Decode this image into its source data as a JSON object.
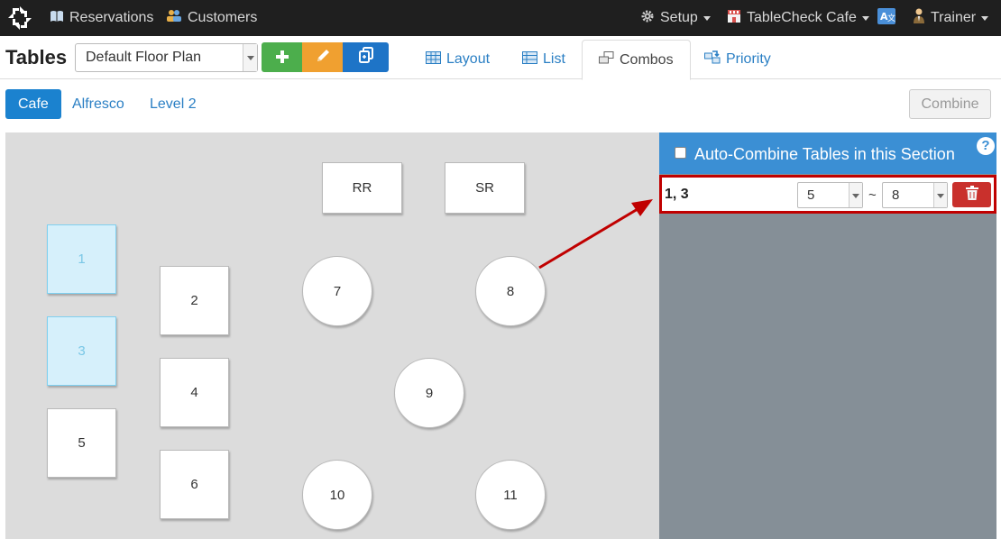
{
  "topnav": {
    "reservations": "Reservations",
    "customers": "Customers",
    "setup": "Setup",
    "venue": "TableCheck Cafe",
    "user": "Trainer"
  },
  "toolbar": {
    "title": "Tables",
    "floor_plan": "Default Floor Plan",
    "add_icon": "plus-icon",
    "edit_icon": "pencil-icon",
    "copy_icon": "copy-icon",
    "tabs": [
      {
        "label": "Layout",
        "icon": "grid-icon",
        "active": false
      },
      {
        "label": "List",
        "icon": "list-icon",
        "active": false
      },
      {
        "label": "Combos",
        "icon": "combo-icon",
        "active": true
      },
      {
        "label": "Priority",
        "icon": "priority-icon",
        "active": false
      }
    ]
  },
  "sections": {
    "items": [
      {
        "label": "Cafe",
        "active": true
      },
      {
        "label": "Alfresco",
        "active": false
      },
      {
        "label": "Level 2",
        "active": false
      }
    ],
    "combine_label": "Combine"
  },
  "floor": {
    "tables": [
      {
        "label": "RR",
        "shape": "rect",
        "selected": false
      },
      {
        "label": "SR",
        "shape": "rect",
        "selected": false
      },
      {
        "label": "1",
        "shape": "rect",
        "selected": true
      },
      {
        "label": "3",
        "shape": "rect",
        "selected": true
      },
      {
        "label": "5",
        "shape": "rect",
        "selected": false
      },
      {
        "label": "2",
        "shape": "rect",
        "selected": false
      },
      {
        "label": "4",
        "shape": "rect",
        "selected": false
      },
      {
        "label": "6",
        "shape": "rect",
        "selected": false
      },
      {
        "label": "7",
        "shape": "round",
        "selected": false
      },
      {
        "label": "8",
        "shape": "round",
        "selected": false
      },
      {
        "label": "9",
        "shape": "round",
        "selected": false
      },
      {
        "label": "10",
        "shape": "round",
        "selected": false
      },
      {
        "label": "11",
        "shape": "round",
        "selected": false
      }
    ]
  },
  "panel": {
    "auto_combine_label": "Auto-Combine Tables in this Section",
    "help": "?",
    "combo": {
      "name": "1, 3",
      "min": "5",
      "separator": "~",
      "max": "8"
    }
  },
  "colors": {
    "nav_bg": "#1f1f1f",
    "accent": "#1b82cf",
    "panel_head": "#3b8fd4",
    "panel_bg": "#858f97",
    "highlight": "#c00000",
    "selected_table": "#d6f0fb"
  }
}
